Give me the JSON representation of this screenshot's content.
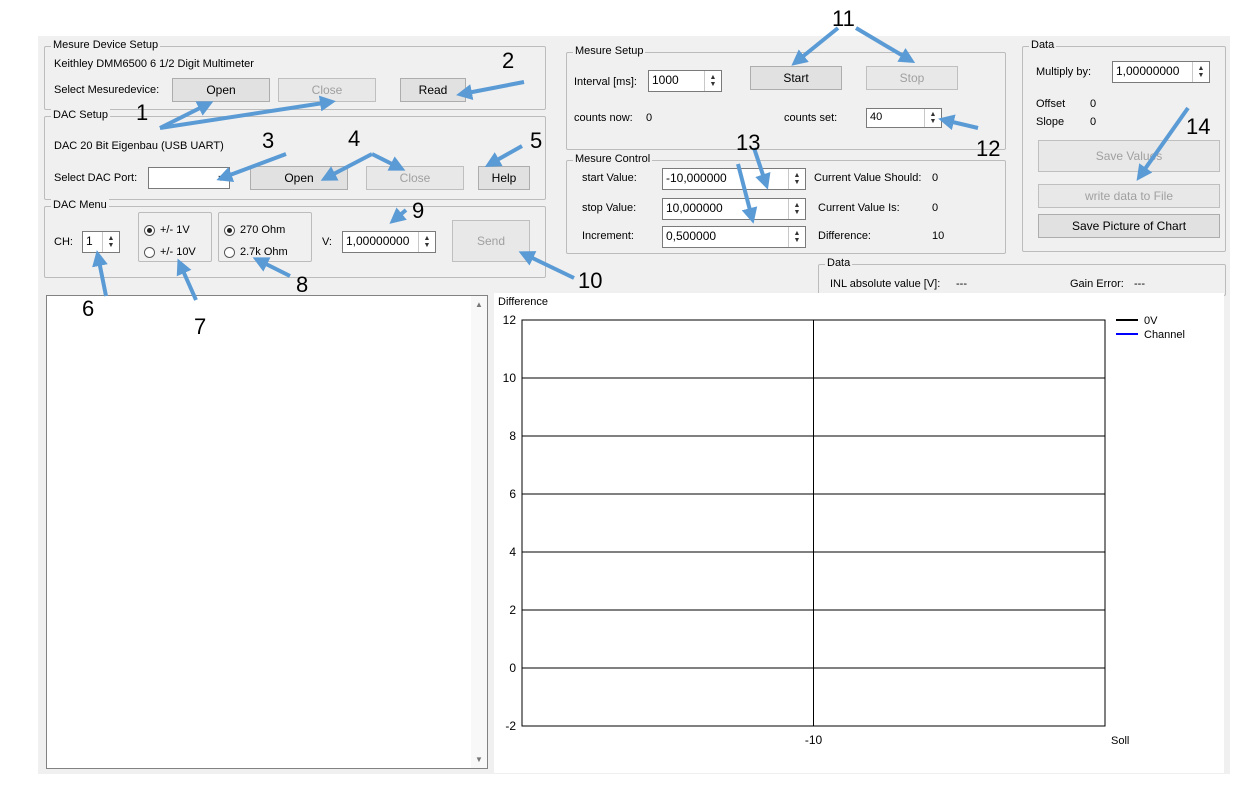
{
  "device_setup": {
    "title": "Mesure Device Setup",
    "device_name": "Keithley DMM6500 6 1/2 Digit Multimeter",
    "select_label": "Select Mesuredevice:",
    "open_label": "Open",
    "close_label": "Close",
    "read_label": "Read",
    "read_value": "---"
  },
  "dac_setup": {
    "title": "DAC Setup",
    "dac_name": "DAC 20 Bit Eigenbau (USB UART)",
    "port_label": "Select DAC Port:",
    "port_value": "",
    "open_label": "Open",
    "close_label": "Close",
    "help_label": "Help"
  },
  "dac_menu": {
    "title": "DAC Menu",
    "ch_label": "CH:",
    "ch_value": "1",
    "range_1v": "+/- 1V",
    "range_10v": "+/- 10V",
    "res_270": "270 Ohm",
    "res_2k7": "2.7k Ohm",
    "v_label": "V:",
    "v_value": "1,00000000",
    "send_label": "Send"
  },
  "mesure_setup": {
    "title": "Mesure Setup",
    "interval_label": "Interval [ms]:",
    "interval_value": "1000",
    "start_label": "Start",
    "stop_label": "Stop",
    "counts_now_label": "counts now:",
    "counts_now_value": "0",
    "counts_set_label": "counts set:",
    "counts_set_value": "40"
  },
  "mesure_control": {
    "title": "Mesure Control",
    "start_label": "start Value:",
    "start_value": "-10,000000",
    "stop_label": "stop Value:",
    "stop_value": "10,000000",
    "inc_label": "Increment:",
    "inc_value": "0,500000",
    "should_label": "Current Value Should:",
    "should_value": "0",
    "is_label": "Current Value Is:",
    "is_value": "0",
    "diff_label": "Difference:",
    "diff_value": "10"
  },
  "data_panel": {
    "title": "Data",
    "multiply_label": "Multiply by:",
    "multiply_value": "1,00000000",
    "offset_label": "Offset",
    "offset_value": "0",
    "slope_label": "Slope",
    "slope_value": "0",
    "save_values_label": "Save Values",
    "write_file_label": "write data to File",
    "save_picture_label": "Save Picture of Chart"
  },
  "data_bottom": {
    "title": "Data",
    "inl_label": "INL absolute value [V]:",
    "inl_value": "---",
    "gain_label": "Gain Error:",
    "gain_value": "---"
  },
  "annotations": [
    "1",
    "2",
    "3",
    "4",
    "5",
    "6",
    "7",
    "8",
    "9",
    "10",
    "11",
    "12",
    "13",
    "14"
  ],
  "colors": {
    "arrow": "#5b9bd5",
    "series_0v": "#000000",
    "series_channel": "#0000ff"
  },
  "chart_data": {
    "type": "line",
    "ylabel": "Difference",
    "xlabel": "Soll",
    "x_ticks": [
      "-10"
    ],
    "y_ticks": [
      12,
      10,
      8,
      6,
      4,
      2,
      0,
      -2
    ],
    "ylim": [
      -2,
      12
    ],
    "grid": true,
    "legend_position": "top-right",
    "series": [
      {
        "name": "0V",
        "color": "#000000",
        "values": []
      },
      {
        "name": "Channel",
        "color": "#0000ff",
        "values": []
      }
    ]
  }
}
